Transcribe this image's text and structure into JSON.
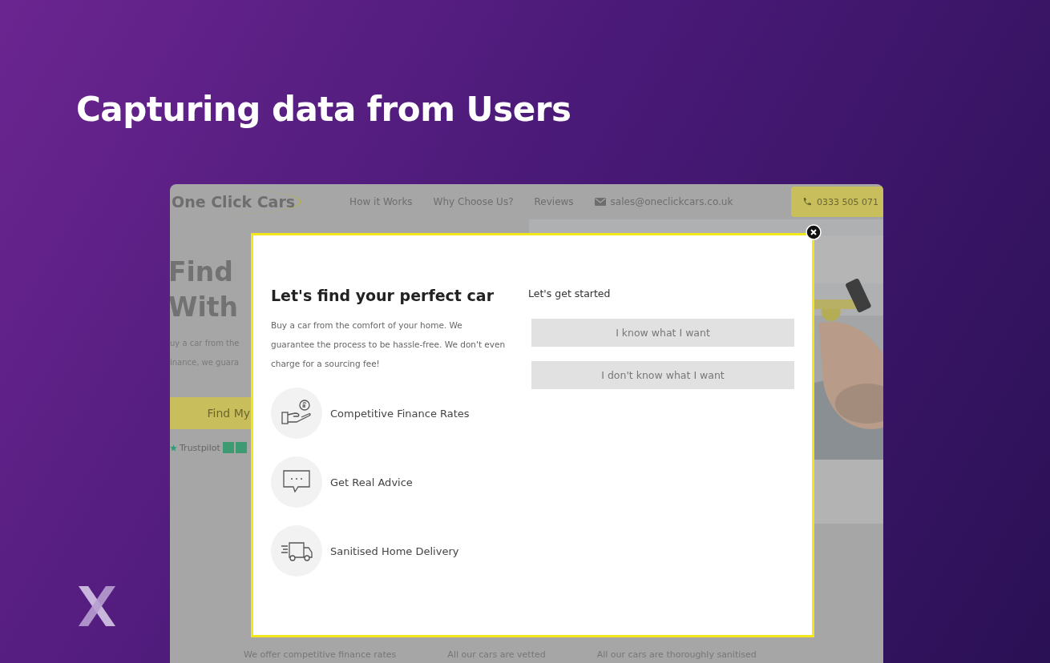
{
  "slide": {
    "title": "Capturing data from Users"
  },
  "site": {
    "logo": "One Click Cars",
    "nav": [
      "How it Works",
      "Why Choose Us?",
      "Reviews"
    ],
    "email": "sales@oneclickcars.co.uk",
    "phone": "0333 505 071",
    "hero": {
      "title_lines": [
        "Find",
        "With"
      ],
      "text_lines": [
        "uy a car from the",
        "inance, we guara"
      ],
      "button": "Find My",
      "trustpilot": "Trustpilot"
    },
    "features": [
      "We offer competitive finance rates",
      "All our cars are vetted",
      "All our cars are thoroughly sanitised"
    ]
  },
  "modal": {
    "title": "Let's find your perfect car",
    "text": "Buy a car from the comfort of your home. We guarantee the process to be hassle-free. We don't even charge for a sourcing fee!",
    "benefits": [
      {
        "kind": "finance",
        "label": "Competitive Finance Rates"
      },
      {
        "kind": "advice",
        "label": "Get Real Advice"
      },
      {
        "kind": "delivery",
        "label": "Sanitised Home Delivery"
      }
    ],
    "prompt": "Let's get started",
    "options": [
      "I know what I want",
      "I don't know what I want"
    ]
  }
}
